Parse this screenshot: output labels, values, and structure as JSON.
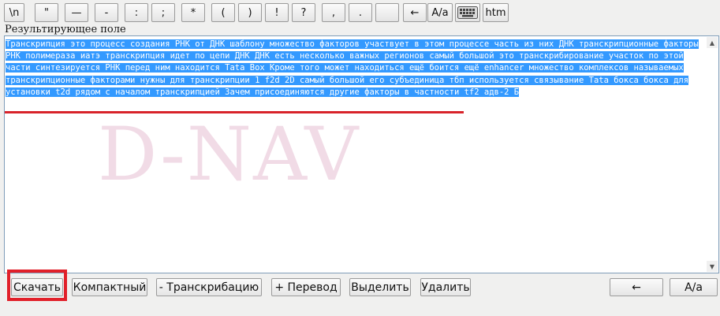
{
  "toolbar": {
    "buttons": [
      "\\n",
      "\"",
      "—",
      "-",
      ":",
      ";",
      "*",
      "(",
      ")",
      "!",
      "?",
      ",",
      ".",
      "",
      "←",
      "A/a",
      "",
      "htm"
    ]
  },
  "result_label": "Результирующее поле",
  "watermark": "D-NAV",
  "text": "Транскрипция это процесс создания РНК от ДНК шаблону множество факторов участвует в этом процессе часть из них ДНК транскрипционные факторы РНК полимераза иатэ транскрипция идет по цепи ДНК ДНК есть несколько важных регионов самый большой это транскрибирование участок по этой части синтезируется РНК перед ним находится Tata Box Кроме того может находиться ещё боится ещё enhancer множество комплексов называемых транскрипционные факторами нужны для транскрипции 1 f2d 2D самый большой его субъединица тбп используется связывание Tata бокса бокса для установки t2d рядом с началом транскрипцией Зачем присоединяются другие факторы в частности tf2 адв-2 Б",
  "bottom": {
    "download": "Скачать",
    "compact": "Компактный",
    "transcribe": "- Транскрибацию",
    "translate": "+ Перевод",
    "select": "Выделить",
    "delete": "Удалить",
    "back": "←",
    "case": "A/a"
  },
  "colors": {
    "selection": "#3399ff",
    "highlight": "#e1202a",
    "background": "#f0f0ef"
  }
}
